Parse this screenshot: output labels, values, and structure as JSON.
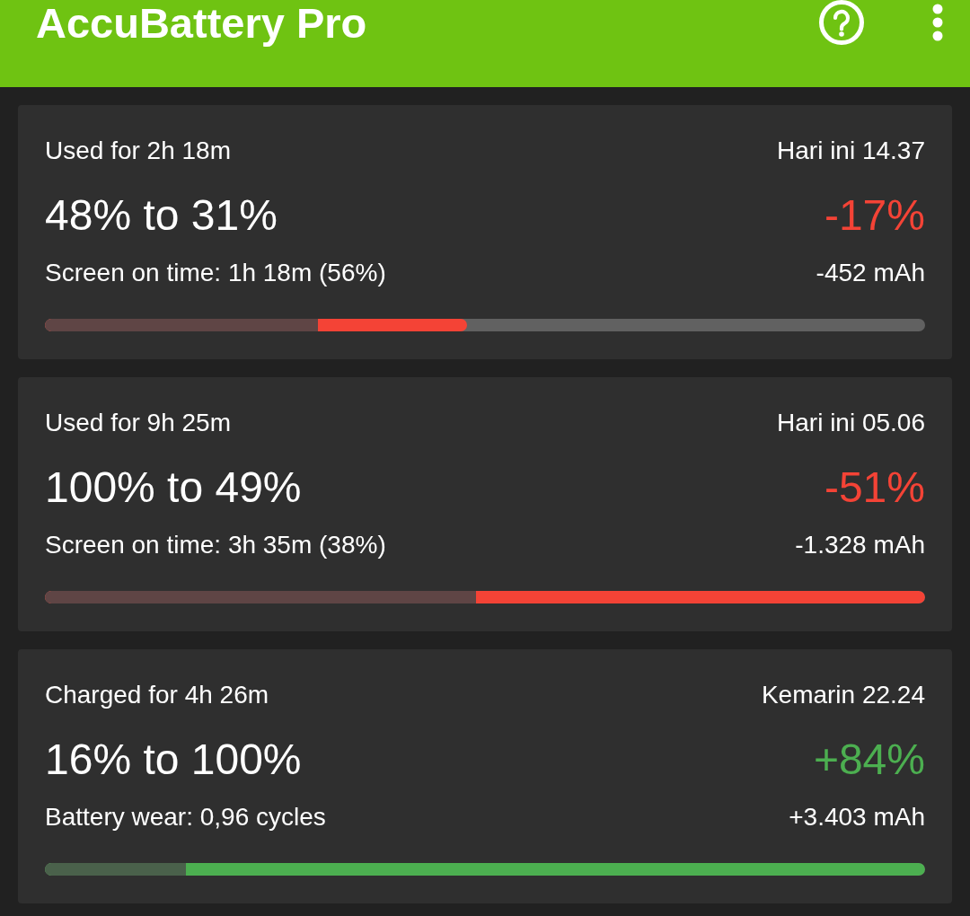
{
  "app_bar": {
    "title": "AccuBattery Pro"
  },
  "sessions": [
    {
      "kind": "discharge",
      "duration": "Used for 2h 18m",
      "time": "Hari ini 14.37",
      "range": "48% to 31%",
      "change": "-17%",
      "detail": "Screen on time: 1h 18m (56%)",
      "capacity": "-452 mAh",
      "bar": {
        "low": {
          "level": 0.31
        },
        "high": {
          "level": 0.48
        }
      }
    },
    {
      "kind": "discharge",
      "duration": "Used for 9h 25m",
      "time": "Hari ini 05.06",
      "range": "100% to 49%",
      "change": "-51%",
      "detail": "Screen on time: 3h 35m (38%)",
      "capacity": "-1.328 mAh",
      "bar": {
        "low": {
          "level": 0.49
        },
        "high": {
          "level": 1
        }
      }
    },
    {
      "kind": "charge",
      "duration": "Charged for 4h 26m",
      "time": "Kemarin 22.24",
      "range": "16% to 100%",
      "change": "+84%",
      "detail": "Battery wear: 0,96 cycles",
      "capacity": "+3.403 mAh",
      "bar": {
        "low": {
          "level": 0.16
        },
        "high": {
          "level": 1
        }
      }
    }
  ]
}
